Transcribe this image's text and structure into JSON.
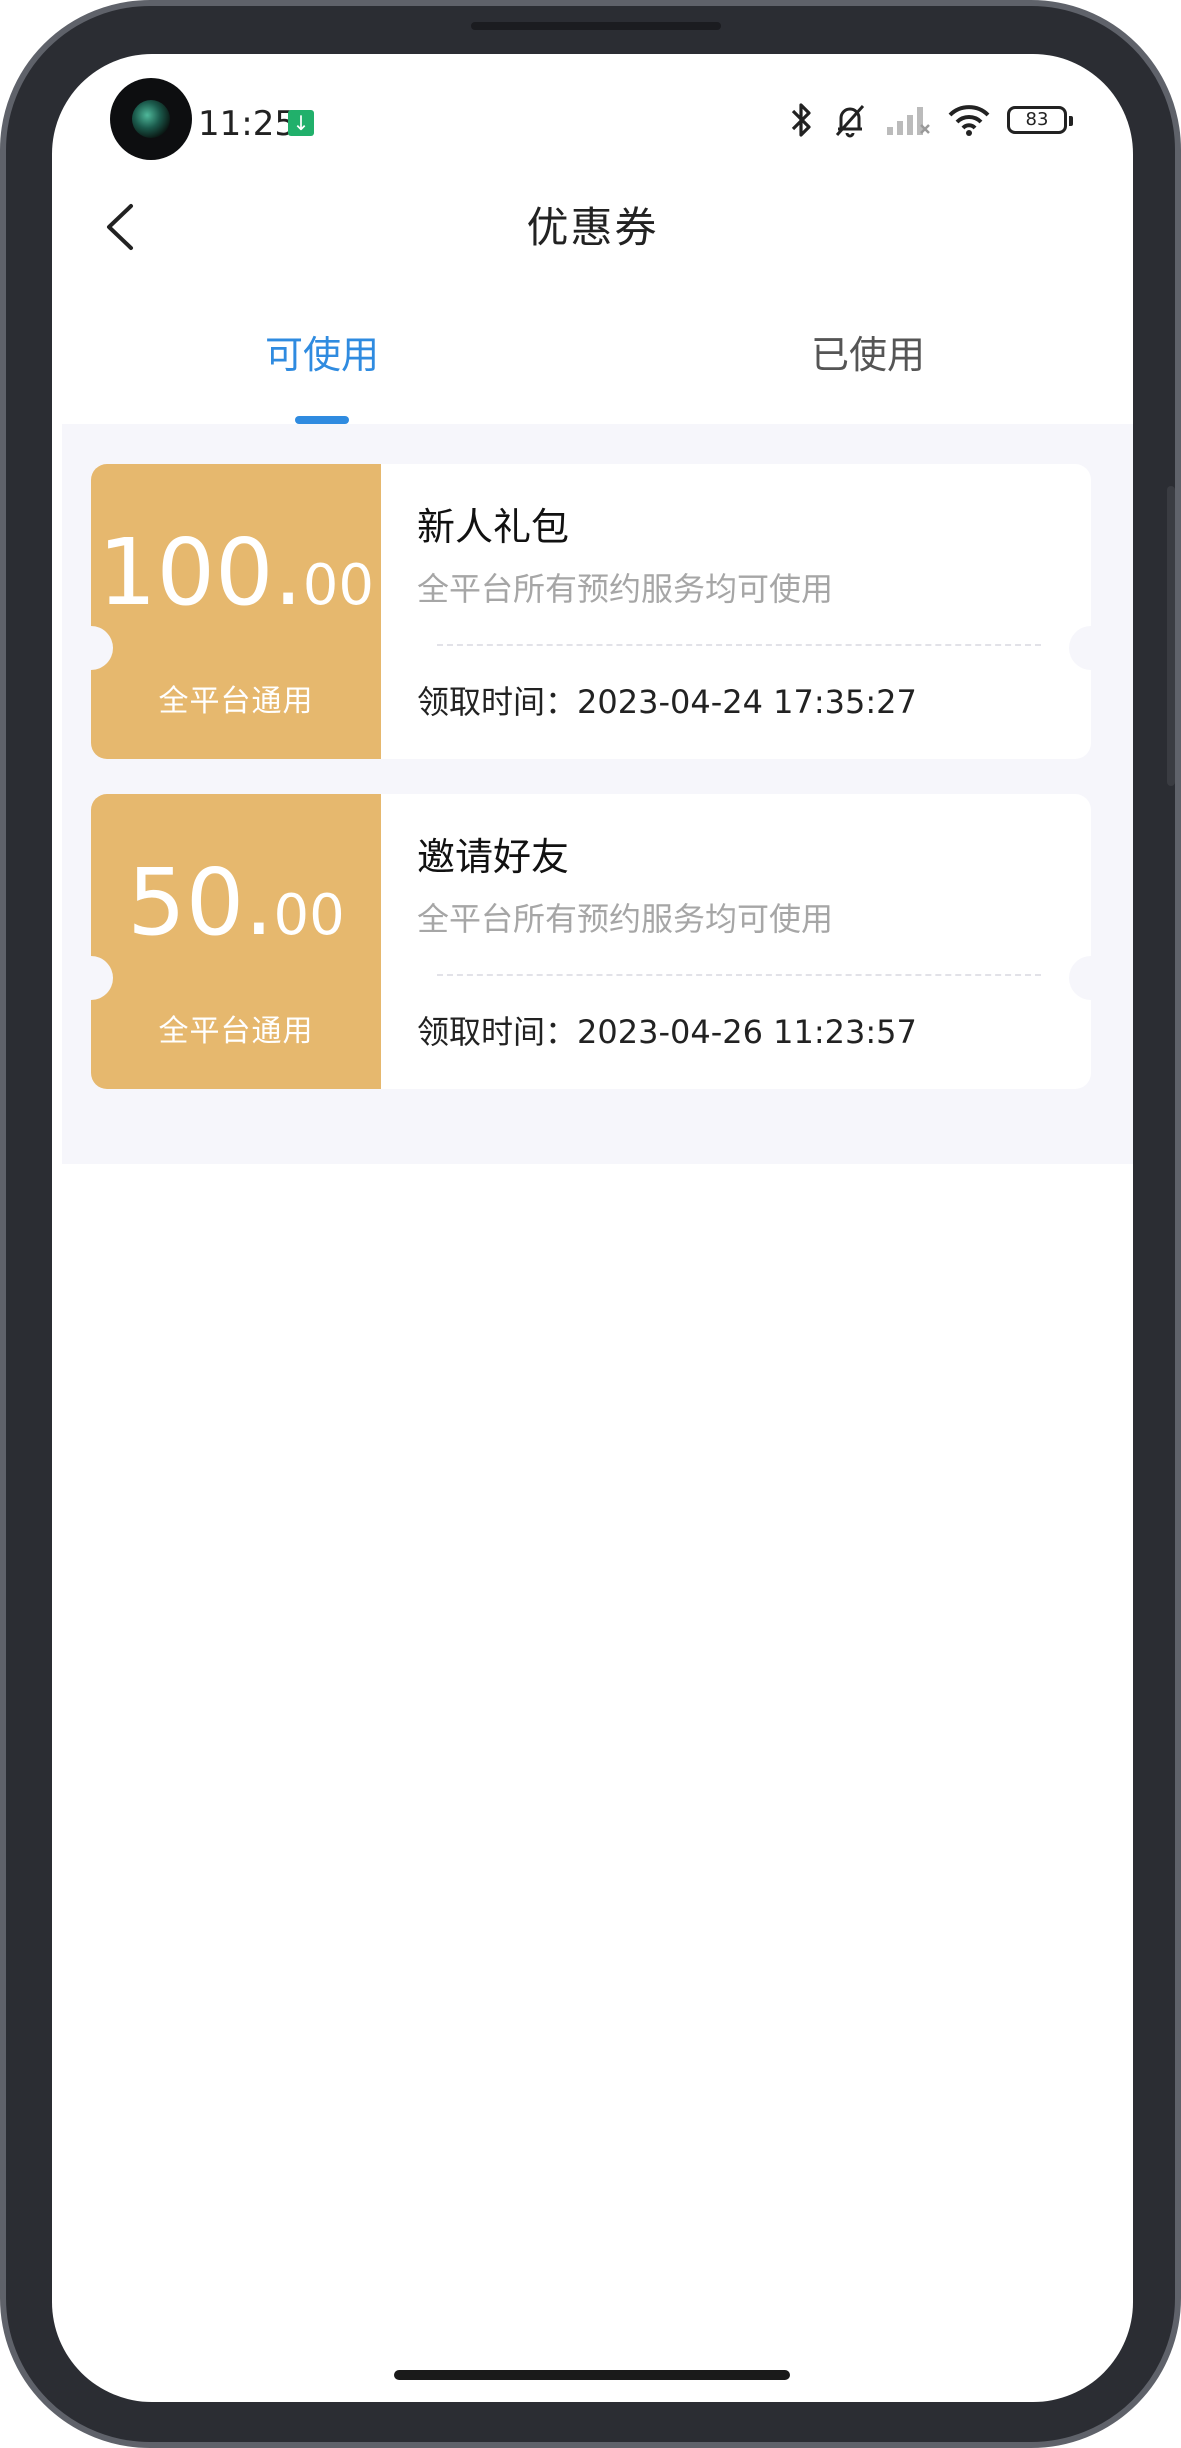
{
  "status_bar": {
    "time": "11:25",
    "download_icon": "download-icon",
    "battery": "83"
  },
  "header": {
    "title": "优惠券",
    "back_icon": "chevron-left-icon"
  },
  "tabs": [
    {
      "label": "可使用",
      "active": true
    },
    {
      "label": "已使用",
      "active": false
    }
  ],
  "coupons": [
    {
      "amount_int": "100.",
      "amount_dec": "00",
      "scope": "全平台通用",
      "name": "新人礼包",
      "description": "全平台所有预约服务均可使用",
      "received_label": "领取时间：",
      "received_time": "2023-04-24 17:35:27"
    },
    {
      "amount_int": "50.",
      "amount_dec": "00",
      "scope": "全平台通用",
      "name": "邀请好友",
      "description": "全平台所有预约服务均可使用",
      "received_label": "领取时间：",
      "received_time": "2023-04-26 11:23:57"
    }
  ],
  "colors": {
    "accent": "#2f8be0",
    "coupon_gold": "#e6b86e",
    "list_background": "#f6f6fb"
  }
}
